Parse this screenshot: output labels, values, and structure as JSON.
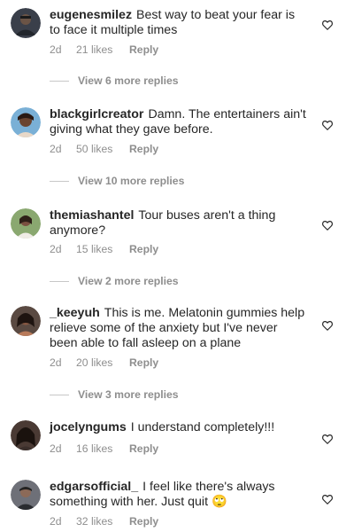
{
  "comments": [
    {
      "username": "eugenesmilez",
      "text": "Best way to beat your fear is to face it multiple times",
      "age": "2d",
      "likes": "21 likes",
      "reply": "Reply",
      "view_replies": "View 6 more replies",
      "avatar_color": "#3a3f4a"
    },
    {
      "username": "blackgirlcreator",
      "text": "Damn. The entertainers ain't giving what they gave before.",
      "age": "2d",
      "likes": "50 likes",
      "reply": "Reply",
      "view_replies": "View 10 more replies",
      "avatar_color": "#7ab0d6"
    },
    {
      "username": "themiashantel",
      "text": "Tour buses aren't a thing anymore?",
      "age": "2d",
      "likes": "15 likes",
      "reply": "Reply",
      "view_replies": "View 2 more replies",
      "avatar_color": "#8aa870"
    },
    {
      "username": "_keeyuh",
      "text": "This is me. Melatonin gummies help relieve some of the anxiety but I've never been able to fall asleep  on a plane",
      "age": "2d",
      "likes": "20 likes",
      "reply": "Reply",
      "view_replies": "View 3 more replies",
      "avatar_color": "#5a4a42"
    },
    {
      "username": "jocelyngums",
      "text": "I understand completely!!!",
      "age": "2d",
      "likes": "16 likes",
      "reply": "Reply",
      "view_replies": "",
      "avatar_color": "#4a3a34"
    },
    {
      "username": "edgarsofficial_",
      "text": "I feel like there's always something with her. Just quit 🙄",
      "age": "2d",
      "likes": "32 likes",
      "reply": "Reply",
      "view_replies": "",
      "avatar_color": "#6e7078"
    }
  ],
  "colors": {
    "text": "#262626",
    "secondary": "#8e8e8e",
    "divider": "#c7c7c7"
  },
  "icons": {
    "like": "heart-outline-icon",
    "avatar": "user-avatar"
  }
}
